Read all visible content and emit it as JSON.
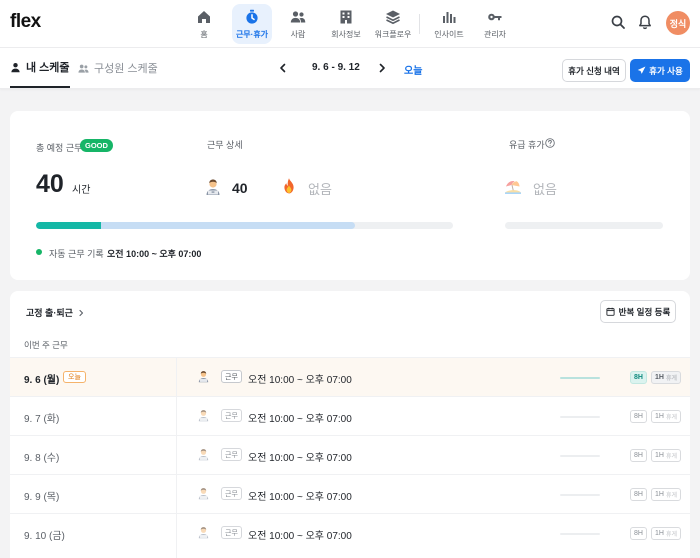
{
  "app": {
    "logo": "flex"
  },
  "nav": {
    "items": [
      {
        "label": "홈",
        "icon": "home-icon"
      },
      {
        "label": "근무·휴가",
        "icon": "stopwatch-icon",
        "active": true
      },
      {
        "label": "사람",
        "icon": "people-icon"
      },
      {
        "label": "회사정보",
        "icon": "building-icon"
      },
      {
        "label": "워크플로우",
        "icon": "layers-icon"
      },
      {
        "label": "인사이트",
        "icon": "bar-chart-icon"
      },
      {
        "label": "관리자",
        "icon": "key-icon"
      }
    ],
    "avatar": "정식",
    "accent": "#1a73e8"
  },
  "subheader": {
    "tabs": [
      {
        "label": "내 스케줄",
        "active": true
      },
      {
        "label": "구성원 스케줄",
        "active": false
      }
    ],
    "week_range": "9. 6 - 9. 12",
    "today_label": "오늘",
    "leave_history_button": "휴가 신청 내역",
    "use_leave_button": "휴가 사용"
  },
  "summary": {
    "total_label": "총 예정 근무",
    "status_badge": "GOOD",
    "total_value": "40",
    "total_unit": "시간",
    "detail_label": "근무 상세",
    "work_hours": "40",
    "overtime": "없음",
    "paid_leave_label": "유급 휴가",
    "paid_leave_value": "없음",
    "progress_done_pct": 15.5,
    "progress_scheduled_pct": 76.5,
    "auto_record_label": "자동 근무 기록",
    "auto_record_time": "오전 10:00 ~ 오후 07:00",
    "status_color": "#16b567"
  },
  "schedule": {
    "fixed_link": "고정 출·퇴근",
    "repeat_button": "반복 일정 등록",
    "week_caption": "이번 주 근무",
    "work_chip": "근무",
    "today_chip": "오늘",
    "rows": [
      {
        "date": "9. 6 (월)",
        "today": true,
        "time": "오전 10:00 ~ 오후 07:00",
        "hours": "8H",
        "break": "1H",
        "break_sub": "휴게"
      },
      {
        "date": "9. 7 (화)",
        "today": false,
        "time": "오전 10:00 ~ 오후 07:00",
        "hours": "8H",
        "break": "1H",
        "break_sub": "휴게"
      },
      {
        "date": "9. 8 (수)",
        "today": false,
        "time": "오전 10:00 ~ 오후 07:00",
        "hours": "8H",
        "break": "1H",
        "break_sub": "휴게"
      },
      {
        "date": "9. 9 (목)",
        "today": false,
        "time": "오전 10:00 ~ 오후 07:00",
        "hours": "8H",
        "break": "1H",
        "break_sub": "휴게"
      },
      {
        "date": "9. 10 (금)",
        "today": false,
        "time": "오전 10:00 ~ 오후 07:00",
        "hours": "8H",
        "break": "1H",
        "break_sub": "휴게"
      }
    ]
  }
}
